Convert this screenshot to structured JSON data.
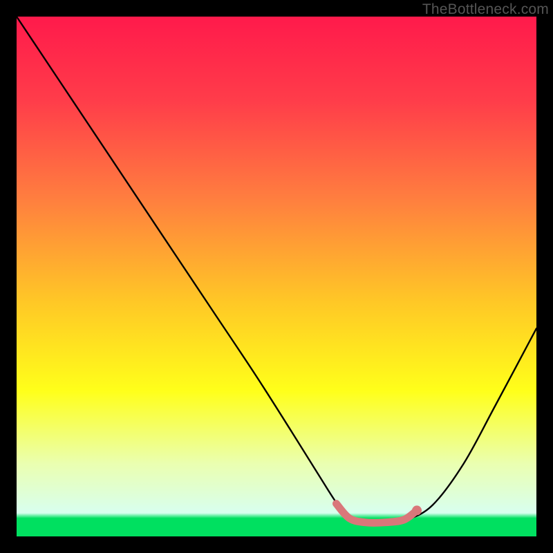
{
  "watermark": "TheBottleneck.com",
  "chart_data": {
    "type": "line",
    "title": "",
    "xlabel": "",
    "ylabel": "",
    "xlim": [
      0,
      100
    ],
    "ylim": [
      0,
      100
    ],
    "gradient_stops": [
      {
        "offset": 0.0,
        "color": "#ff1a4b"
      },
      {
        "offset": 0.16,
        "color": "#ff3c4a"
      },
      {
        "offset": 0.35,
        "color": "#ff7e3f"
      },
      {
        "offset": 0.55,
        "color": "#ffc826"
      },
      {
        "offset": 0.72,
        "color": "#ffff1a"
      },
      {
        "offset": 0.86,
        "color": "#eaffb0"
      },
      {
        "offset": 0.955,
        "color": "#d8ffef"
      },
      {
        "offset": 0.965,
        "color": "#00e060"
      },
      {
        "offset": 1.0,
        "color": "#00e060"
      }
    ],
    "series": [
      {
        "name": "bottleneck-curve",
        "color": "#000000",
        "x": [
          0,
          3,
          8,
          15,
          22,
          30,
          38,
          46,
          53,
          58,
          61.5,
          64,
          67,
          71,
          75,
          80,
          86,
          92,
          100
        ],
        "y": [
          100,
          95.5,
          88,
          77.5,
          67,
          55,
          43,
          31,
          20,
          12,
          6.5,
          3.5,
          2.7,
          2.7,
          3.2,
          6,
          14,
          25,
          40
        ]
      },
      {
        "name": "optimal-zone",
        "color": "#d9777a",
        "x": [
          61.5,
          64,
          67,
          71,
          74.5,
          77
        ],
        "y": [
          6.3,
          3.5,
          2.7,
          2.7,
          3.2,
          5.0
        ]
      }
    ],
    "markers": [
      {
        "name": "optimal-start",
        "x": 61.5,
        "y": 6.3,
        "r": 5,
        "color": "#d9777a"
      },
      {
        "name": "optimal-end",
        "x": 77,
        "y": 5.0,
        "r": 7,
        "color": "#d9777a"
      }
    ]
  }
}
